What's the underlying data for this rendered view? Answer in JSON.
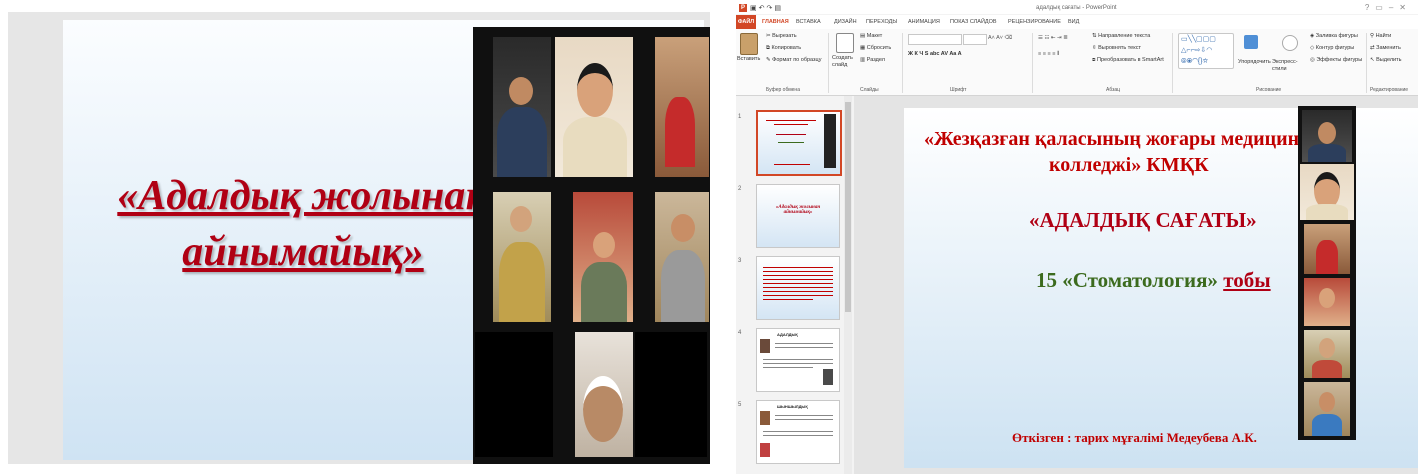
{
  "left_slide": {
    "title": "«Адалдық жолынан айнымайық»"
  },
  "powerpoint": {
    "window_title": "адалдық сағаты - PowerPoint",
    "tabs": [
      "ФАЙЛ",
      "ГЛАВНАЯ",
      "ВСТАВКА",
      "ДИЗАЙН",
      "ПЕРЕХОДЫ",
      "АНИМАЦИЯ",
      "ПОКАЗ СЛАЙДОВ",
      "РЕЦЕНЗИРОВАНИЕ",
      "ВИД"
    ],
    "ribbon": {
      "paste": "Вставить",
      "cut": "Вырезать",
      "copy": "Копировать",
      "format_painter": "Формат по образцу",
      "clipboard_group": "Буфер обмена",
      "new_slide": "Создать слайд",
      "layout": "Макет",
      "reset": "Сбросить",
      "section": "Раздел",
      "slides_group": "Слайды",
      "font_group": "Шрифт",
      "text_direction": "Направление текста",
      "align_text": "Выровнять текст",
      "smartart": "Преобразовать в SmartArt",
      "paragraph_group": "Абзац",
      "arrange": "Упорядочить",
      "quick_styles": "Экспресс-стили",
      "shape_fill": "Заливка фигуры",
      "shape_outline": "Контур фигуры",
      "shape_effects": "Эффекты фигуры",
      "drawing_group": "Рисование",
      "find": "Найти",
      "replace": "Заменить",
      "select": "Выделить",
      "editing_group": "Редактирование"
    },
    "thumbnails": {
      "numbers": [
        "1",
        "2",
        "3",
        "4",
        "5"
      ],
      "t2_title": "«Адалдық жолынан айнымайық»",
      "t4_title": "АДАЛДЫҚ",
      "t5_title": "ШЫНШЫЛДЫҚ"
    },
    "main_slide": {
      "line1": "«Жезқазған қаласының жоғары медициналық",
      "line2": "колледжі» КМҚК",
      "line3": "«АДАЛДЫҚ САҒАТЫ»",
      "line4": "15 «Стоматология»",
      "line4b": "тобы",
      "line5": "Өткізген : тарих мұғалімі Медеубева А.К."
    }
  }
}
